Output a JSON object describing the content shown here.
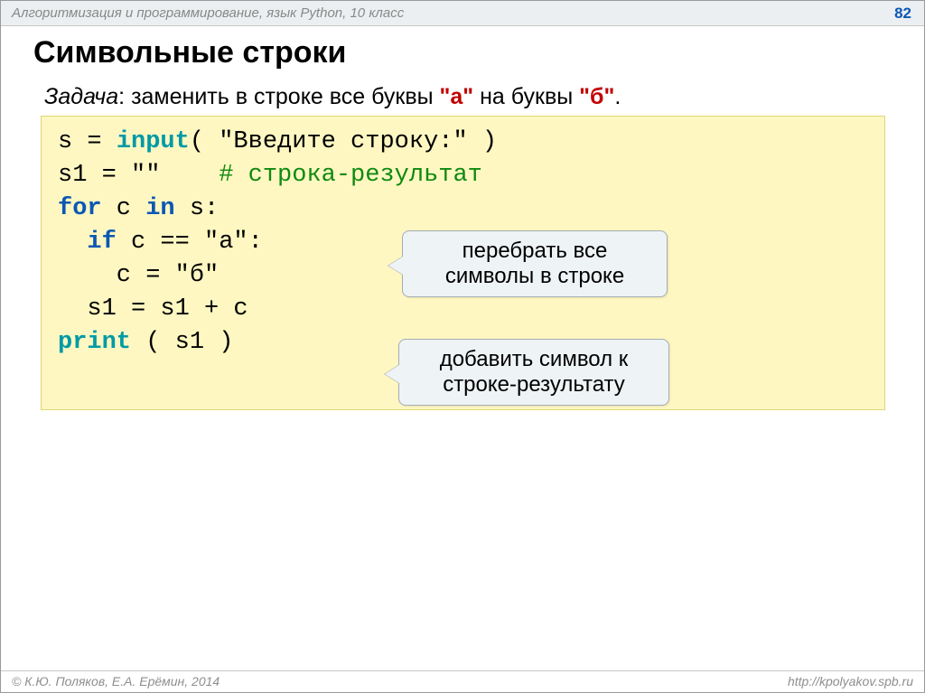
{
  "header": {
    "title": "Алгоритмизация и программирование, язык Python, 10 класс",
    "page": "82"
  },
  "heading": "Символьные строки",
  "task": {
    "label": "Задача",
    "colon": ": ",
    "pre": "заменить в строке все буквы ",
    "a": "\"а\"",
    "mid": " на буквы ",
    "b": "\"б\"",
    "end": "."
  },
  "code": {
    "l1_a": "s = ",
    "l1_b": "input",
    "l1_c": "( ",
    "l1_str": "\"Введите строку:\"",
    "l1_d": " )",
    "l2_a": "s1 = ",
    "l2_b": "\"\"",
    "l2_sp": "    ",
    "l2_cmt": "# строка-результат",
    "l3_for": "for",
    "l3_sp1": " c ",
    "l3_in": "in",
    "l3_sp2": " s:",
    "l4_if": "  if",
    "l4_rest": " c == ",
    "l4_str": "\"а\"",
    "l4_end": ":",
    "l5_pre": "    c = ",
    "l5_str": "\"б\"",
    "l6": "  s1 = s1 + c",
    "l7_print": "print",
    "l7_rest": " ( s1 )"
  },
  "callouts": {
    "c1_l1": "перебрать все",
    "c1_l2": "символы в строке",
    "c2_l1": "добавить символ к",
    "c2_l2": "строке-результату"
  },
  "footer": {
    "left": "© К.Ю. Поляков, Е.А. Ерёмин, 2014",
    "right": "http://kpolyakov.spb.ru"
  }
}
